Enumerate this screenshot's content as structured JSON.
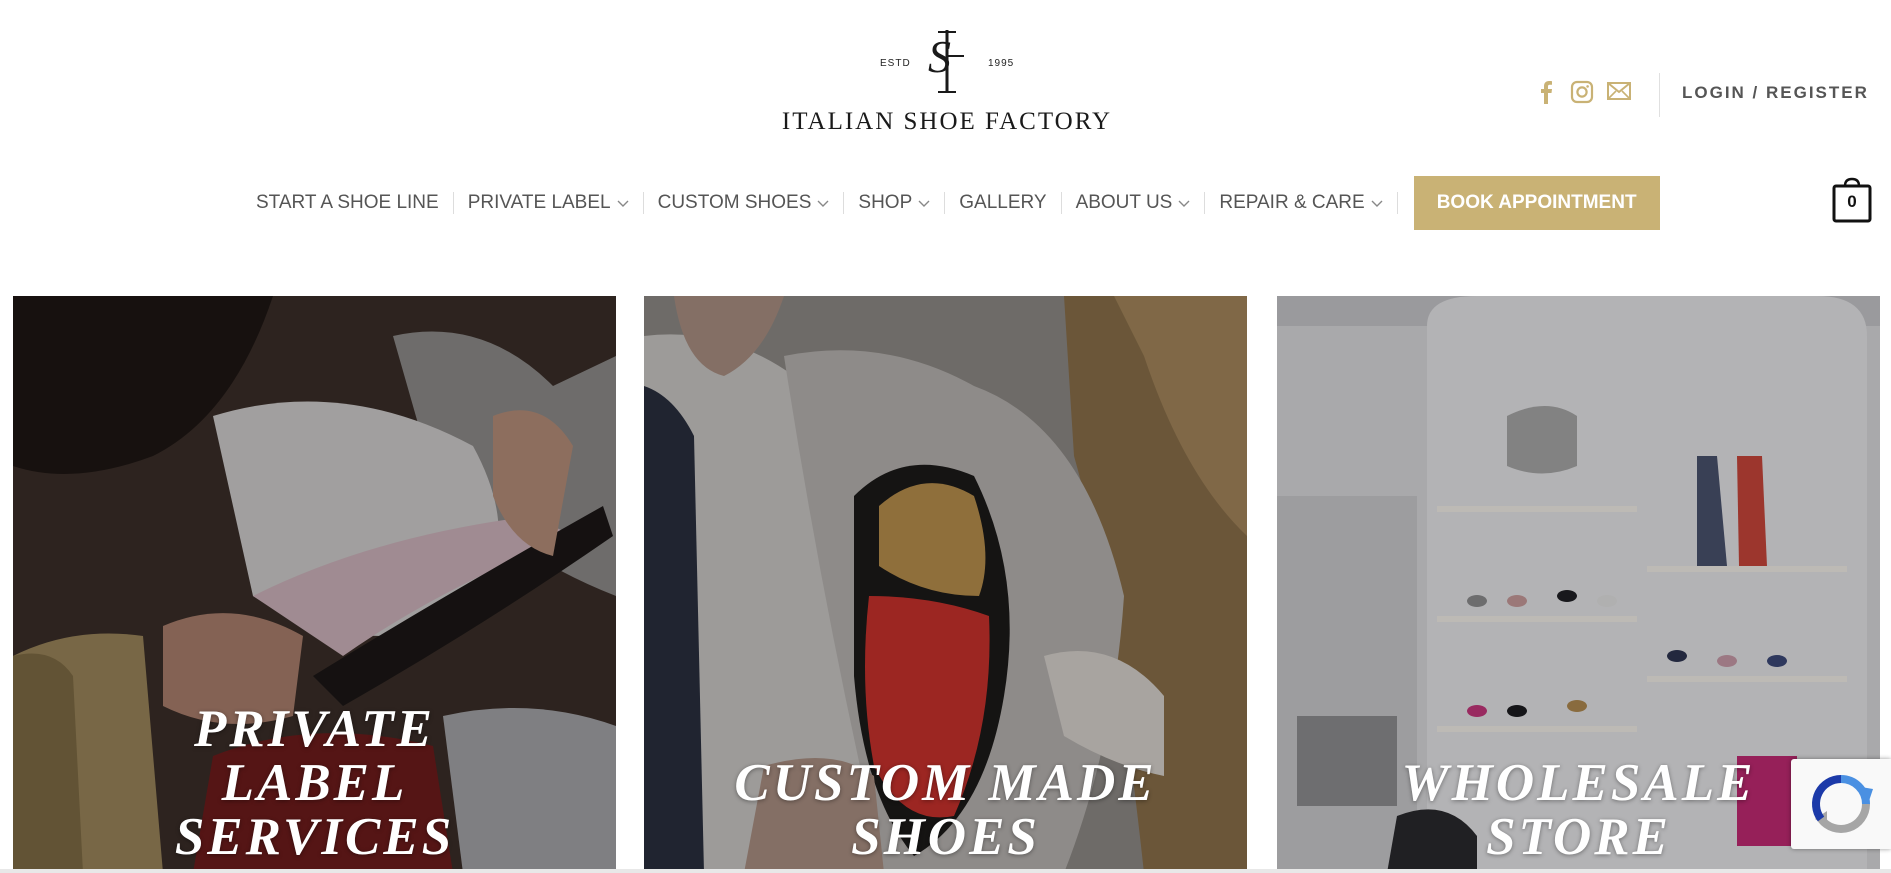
{
  "brand": {
    "estd": "ESTD",
    "year": "1995",
    "name": "ITALIAN SHOE FACTORY",
    "monogram": "ISF"
  },
  "header": {
    "social_icons": [
      "facebook-icon",
      "instagram-icon",
      "mail-icon"
    ],
    "login_label": "LOGIN / REGISTER",
    "cart_count": "0"
  },
  "nav": {
    "items": [
      {
        "label": "START A SHOE LINE",
        "dropdown": false
      },
      {
        "label": "PRIVATE LABEL",
        "dropdown": true
      },
      {
        "label": "CUSTOM SHOES",
        "dropdown": true
      },
      {
        "label": "SHOP",
        "dropdown": true
      },
      {
        "label": "GALLERY",
        "dropdown": false
      },
      {
        "label": "ABOUT US",
        "dropdown": true
      },
      {
        "label": "REPAIR & CARE",
        "dropdown": true
      }
    ],
    "cta_label": "BOOK APPOINTMENT"
  },
  "tiles": [
    {
      "lines": [
        "PRIVATE",
        "LABEL",
        "SERVICES"
      ]
    },
    {
      "lines": [
        "CUSTOM MADE",
        "SHOES"
      ]
    },
    {
      "lines": [
        "WHOLESALE",
        "STORE"
      ]
    }
  ],
  "colors": {
    "accent": "#c9b275",
    "nav_text": "#555555",
    "icon": "#c9b275"
  }
}
